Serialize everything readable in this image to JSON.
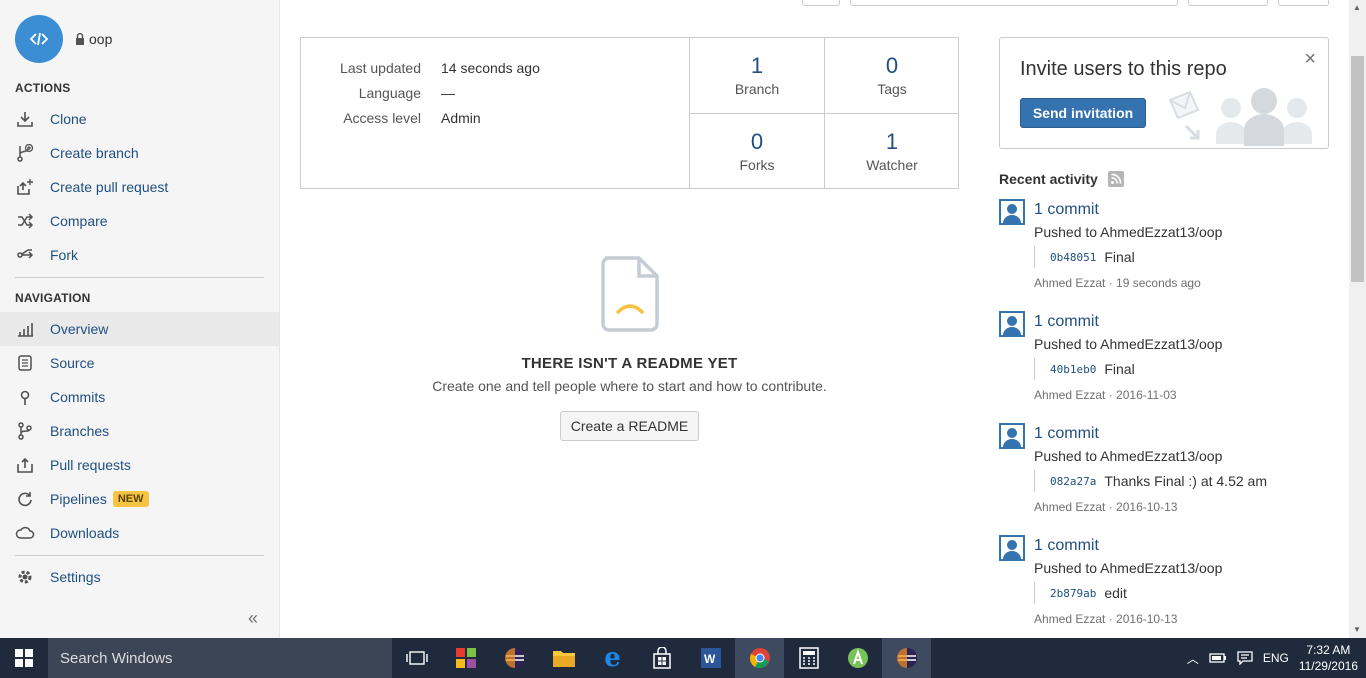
{
  "repo": {
    "name": "oop",
    "lock_icon": "lock-icon",
    "avatar_icon": "code-icon"
  },
  "actions": {
    "title": "ACTIONS",
    "items": [
      {
        "label": "Clone",
        "icon": "download-icon"
      },
      {
        "label": "Create branch",
        "icon": "branch-add-icon"
      },
      {
        "label": "Create pull request",
        "icon": "pull-request-add-icon"
      },
      {
        "label": "Compare",
        "icon": "shuffle-icon"
      },
      {
        "label": "Fork",
        "icon": "fork-icon"
      }
    ]
  },
  "navigation": {
    "title": "NAVIGATION",
    "items": [
      {
        "label": "Overview",
        "icon": "chart-icon",
        "active": true
      },
      {
        "label": "Source",
        "icon": "document-icon"
      },
      {
        "label": "Commits",
        "icon": "commit-icon"
      },
      {
        "label": "Branches",
        "icon": "branch-icon"
      },
      {
        "label": "Pull requests",
        "icon": "pull-request-icon"
      },
      {
        "label": "Pipelines",
        "icon": "refresh-icon",
        "badge": "NEW"
      },
      {
        "label": "Downloads",
        "icon": "cloud-icon"
      }
    ]
  },
  "settings": {
    "label": "Settings",
    "icon": "gear-icon"
  },
  "collapse_glyph": "«",
  "info": {
    "rows": [
      {
        "key": "Last updated",
        "value": "14 seconds ago"
      },
      {
        "key": "Language",
        "value": "—"
      },
      {
        "key": "Access level",
        "value": "Admin"
      }
    ],
    "stats": [
      {
        "num": "1",
        "label": "Branch"
      },
      {
        "num": "0",
        "label": "Tags"
      },
      {
        "num": "0",
        "label": "Forks"
      },
      {
        "num": "1",
        "label": "Watcher"
      }
    ]
  },
  "readme": {
    "title": "THERE ISN'T A README YET",
    "text": "Create one and tell people where to start and how to contribute.",
    "button": "Create a README"
  },
  "invite": {
    "title": "Invite users to this repo",
    "button": "Send invitation",
    "close": "×"
  },
  "recent": {
    "title": "Recent activity",
    "items": [
      {
        "link": "1 commit",
        "sub": "Pushed to AhmedEzzat13/oop",
        "hash": "0b48051",
        "msg": "Final",
        "author": "Ahmed Ezzat",
        "time": "19 seconds ago"
      },
      {
        "link": "1 commit",
        "sub": "Pushed to AhmedEzzat13/oop",
        "hash": "40b1eb0",
        "msg": "Final",
        "author": "Ahmed Ezzat",
        "time": "2016-11-03"
      },
      {
        "link": "1 commit",
        "sub": "Pushed to AhmedEzzat13/oop",
        "hash": "082a27a",
        "msg": "Thanks Final :) at 4.52 am",
        "author": "Ahmed Ezzat",
        "time": "2016-10-13"
      },
      {
        "link": "1 commit",
        "sub": "Pushed to AhmedEzzat13/oop",
        "hash": "2b879ab",
        "msg": "edit",
        "author": "Ahmed Ezzat",
        "time": "2016-10-13"
      }
    ]
  },
  "taskbar": {
    "search": "Search Windows",
    "lang": "ENG",
    "time": "7:32 AM",
    "date": "11/29/2016"
  }
}
